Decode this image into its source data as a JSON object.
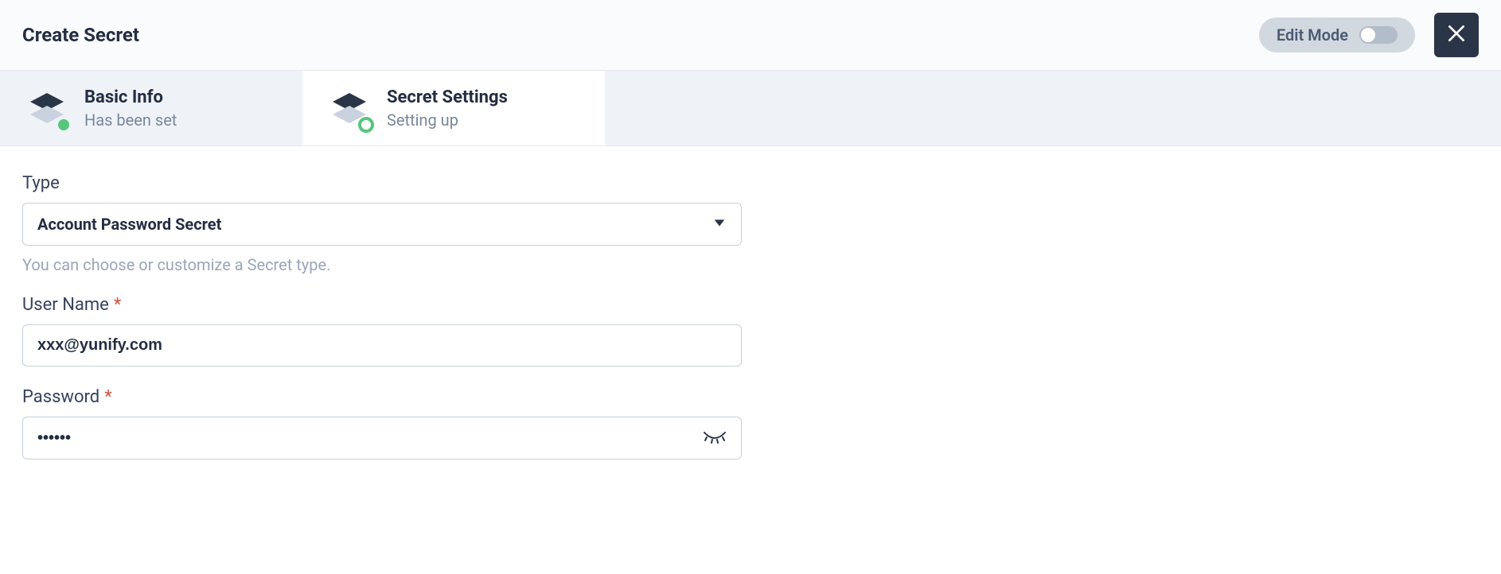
{
  "header": {
    "title": "Create Secret",
    "edit_mode_label": "Edit Mode"
  },
  "steps": [
    {
      "title": "Basic Info",
      "subtitle": "Has been set",
      "status": "done"
    },
    {
      "title": "Secret Settings",
      "subtitle": "Setting up",
      "status": "current"
    }
  ],
  "form": {
    "type": {
      "label": "Type",
      "value": "Account Password Secret",
      "helper": "You can choose or customize a Secret type."
    },
    "username": {
      "label": "User Name",
      "required": true,
      "value": "xxx@yunify.com"
    },
    "password": {
      "label": "Password",
      "required": true,
      "value": "••••••"
    }
  }
}
